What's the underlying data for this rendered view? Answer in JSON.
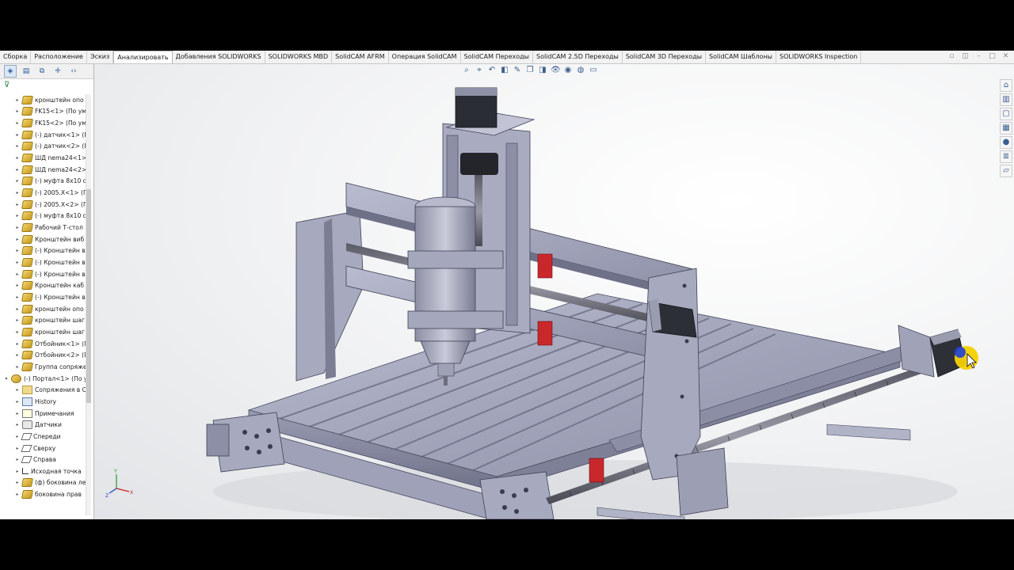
{
  "ribbon": {
    "tabs": [
      {
        "label": "Сборка",
        "active": false
      },
      {
        "label": "Расположение",
        "active": false
      },
      {
        "label": "Эскиз",
        "active": false
      },
      {
        "label": "Анализировать",
        "active": true
      },
      {
        "label": "Добавления SOLIDWORKS",
        "active": false
      },
      {
        "label": "SOLIDWORKS MBD",
        "active": false
      },
      {
        "label": "SolidCAM AFRM",
        "active": false
      },
      {
        "label": "Операция SolidCAM",
        "active": false
      },
      {
        "label": "SolidCAM Переходы",
        "active": false
      },
      {
        "label": "SolidCAM 2.5D Переходы",
        "active": false
      },
      {
        "label": "SolidCAM 3D Переходы",
        "active": false
      },
      {
        "label": "SolidCAM Шаблоны",
        "active": false
      },
      {
        "label": "SOLIDWORKS Inspection",
        "active": false
      }
    ]
  },
  "feature_tree": {
    "items": [
      {
        "label": "кронштейн опо",
        "icon": "part-icon",
        "indent": 1
      },
      {
        "label": "FK15<1> (По ум",
        "icon": "part-icon",
        "indent": 1
      },
      {
        "label": "FK15<2> (По ум",
        "icon": "part-icon",
        "indent": 1
      },
      {
        "label": "(-) датчик<1> (П",
        "icon": "part-icon",
        "indent": 1
      },
      {
        "label": "(-) датчик<2> (П",
        "icon": "part-icon",
        "indent": 1
      },
      {
        "label": "ШД nema24<1>",
        "icon": "part-icon",
        "indent": 1
      },
      {
        "label": "ШД nema24<2>",
        "icon": "part-icon",
        "indent": 1
      },
      {
        "label": "(-) муфта 8x10 d",
        "icon": "part-icon",
        "indent": 1
      },
      {
        "label": "(-) 2005.X<1> (Г",
        "icon": "part-icon",
        "indent": 1
      },
      {
        "label": "(-) 2005.X<2> (Г",
        "icon": "part-icon",
        "indent": 1
      },
      {
        "label": "(-) муфта 8x10 d",
        "icon": "part-icon",
        "indent": 1
      },
      {
        "label": "Рабочий Т-стол",
        "icon": "part-icon",
        "indent": 1
      },
      {
        "label": "Кронштейн виб",
        "icon": "part-icon",
        "indent": 1
      },
      {
        "label": "(-) Кронштейн в",
        "icon": "part-icon",
        "indent": 1
      },
      {
        "label": "(-) Кронштейн в",
        "icon": "part-icon",
        "indent": 1
      },
      {
        "label": "(-) Кронштейн в",
        "icon": "part-icon",
        "indent": 1
      },
      {
        "label": "Кронштейн каб",
        "icon": "part-icon",
        "indent": 1
      },
      {
        "label": "(-) Кронштейн в",
        "icon": "part-icon",
        "indent": 1
      },
      {
        "label": "кронштейн опо",
        "icon": "part-icon",
        "indent": 1
      },
      {
        "label": "кронштейн шаг",
        "icon": "part-icon",
        "indent": 1
      },
      {
        "label": "кронштейн шаг",
        "icon": "part-icon",
        "indent": 1
      },
      {
        "label": "Отбойник<1> (П",
        "icon": "part-icon",
        "indent": 1
      },
      {
        "label": "Отбойник<2> (П",
        "icon": "part-icon",
        "indent": 1
      },
      {
        "label": "Группа сопряже",
        "icon": "part-icon",
        "indent": 1
      },
      {
        "label": "(-) Портал<1> (По у",
        "icon": "asm-icon",
        "indent": 0
      },
      {
        "label": "Сопряжения в С",
        "icon": "folder-icon",
        "indent": 1
      },
      {
        "label": "History",
        "icon": "history-icon",
        "indent": 1
      },
      {
        "label": "Примечания",
        "icon": "notes-icon",
        "indent": 1
      },
      {
        "label": "Датчики",
        "icon": "sensor-icon",
        "indent": 1
      },
      {
        "label": "Спереди",
        "icon": "plane-icon",
        "indent": 1
      },
      {
        "label": "Сверху",
        "icon": "plane-icon",
        "indent": 1
      },
      {
        "label": "Справа",
        "icon": "plane-icon",
        "indent": 1
      },
      {
        "label": "Исходная точка",
        "icon": "origin-icon",
        "indent": 1
      },
      {
        "label": "(ф) боковина ле",
        "icon": "part-icon",
        "indent": 1
      },
      {
        "label": "боковина прав",
        "icon": "part-icon",
        "indent": 1
      }
    ]
  },
  "triad": {
    "x": "X",
    "y": "Y",
    "z": "Z"
  },
  "colors": {
    "accent": "#2a5aa0",
    "model": "#a8aabf",
    "rail_red": "#c8282c",
    "cursor": "#f5d000"
  }
}
